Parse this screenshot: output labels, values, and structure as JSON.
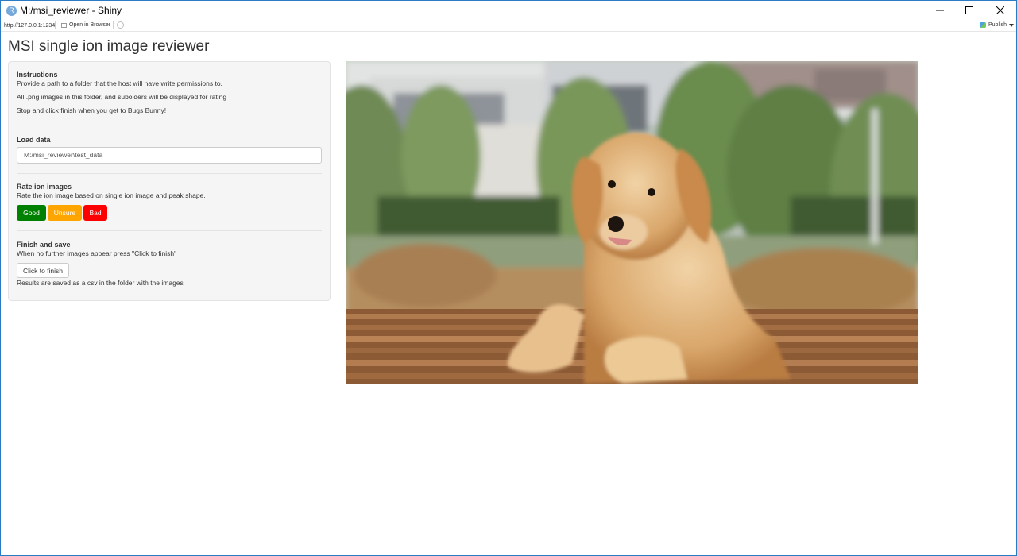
{
  "window": {
    "title": "M:/msi_reviewer - Shiny",
    "app_icon_letter": "R"
  },
  "toolbar": {
    "url": "http://127.0.0.1:1234",
    "open_in_browser": "Open in Browser",
    "publish": "Publish"
  },
  "page": {
    "title": "MSI single ion image reviewer"
  },
  "instructions": {
    "heading": "Instructions",
    "line1": "Provide a path to a folder that the host will have write permissions to.",
    "line2": "All .png images in this folder, and subolders will be displayed for rating",
    "line3": "Stop and click finish when you get to Bugs Bunny!"
  },
  "load_data": {
    "heading": "Load data",
    "path_value": "M:/msi_reviewer\\test_data"
  },
  "rate": {
    "heading": "Rate ion images",
    "description": "Rate the ion image based on single ion image and peak shape.",
    "good_label": "Good",
    "unsure_label": "Unsure",
    "bad_label": "Bad"
  },
  "finish": {
    "heading": "Finish and save",
    "description": "When no further images appear press \"Click to finish\"",
    "button_label": "Click to finish",
    "note": "Results are saved as a csv in the folder with the images"
  },
  "colors": {
    "good": "#008000",
    "unsure": "#ffa500",
    "bad": "#ff0000"
  },
  "image": {
    "subject": "golden retriever puppy on a wooden bench"
  }
}
